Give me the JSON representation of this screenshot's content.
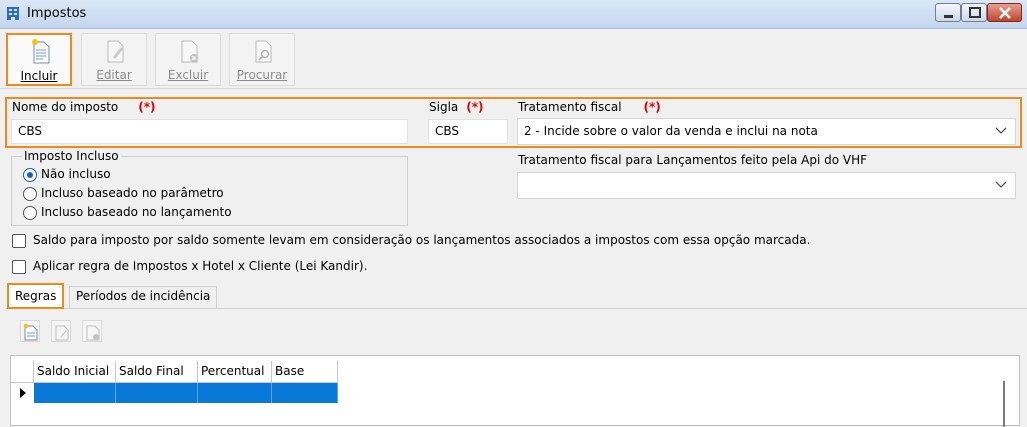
{
  "window": {
    "title": "Impostos",
    "icon": "building-icon",
    "controls": [
      "minimize-icon",
      "maximize-icon",
      "close-icon"
    ]
  },
  "toolbar": {
    "buttons": [
      {
        "label": "Incluir",
        "icon": "new-document-icon",
        "enabled": true
      },
      {
        "label": "Editar",
        "icon": "edit-document-icon",
        "enabled": false
      },
      {
        "label": "Excluir",
        "icon": "delete-document-icon",
        "enabled": false
      },
      {
        "label": "Procurar",
        "icon": "search-document-icon",
        "enabled": false
      }
    ]
  },
  "form": {
    "nome_label": "Nome do imposto",
    "nome_value": "CBS",
    "sigla_label": "Sigla",
    "sigla_value": "CBS",
    "tratamento_label": "Tratamento fiscal",
    "tratamento_value": "2 - Incide sobre o valor da venda e inclui na nota",
    "required_mark": "(*)",
    "tratamento_api_label": "Tratamento fiscal para Lançamentos feito pela Api do VHF",
    "tratamento_api_value": ""
  },
  "imposto_incluso": {
    "title": "Imposto Incluso",
    "options": [
      {
        "label": "Não incluso",
        "checked": true
      },
      {
        "label": "Incluso baseado no parâmetro",
        "checked": false
      },
      {
        "label": "Incluso baseado no lançamento",
        "checked": false
      }
    ]
  },
  "checkboxes": [
    {
      "label": "Saldo para imposto por saldo somente levam em consideração os lançamentos associados a impostos com essa opção marcada.",
      "checked": false
    },
    {
      "label": "Aplicar regra de Impostos x Hotel x Cliente (Lei Kandir).",
      "checked": false
    }
  ],
  "tabs": [
    {
      "label": "Regras",
      "active": true
    },
    {
      "label": "Períodos de incidência",
      "active": false
    }
  ],
  "grid": {
    "columns": [
      "Saldo Inicial",
      "Saldo Final",
      "Percentual",
      "Base"
    ],
    "selected_row": [
      "",
      "",
      "",
      ""
    ]
  },
  "colors": {
    "highlight": "#f08a1d",
    "required": "#e00000",
    "selection": "#0a78d7"
  }
}
